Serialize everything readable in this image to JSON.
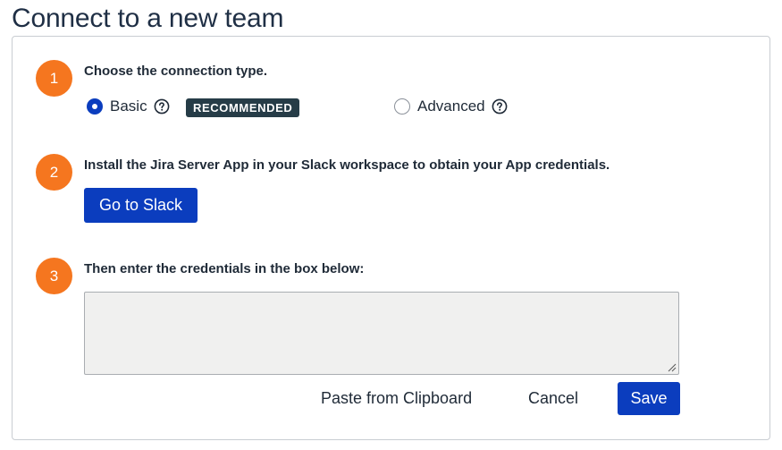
{
  "page": {
    "title": "Connect to a new team"
  },
  "steps": [
    {
      "number": "1",
      "text": "Choose the connection type."
    },
    {
      "number": "2",
      "text": "Install the Jira Server App in your Slack workspace to obtain your App credentials."
    },
    {
      "number": "3",
      "text": "Then enter the credentials in the box below:"
    }
  ],
  "connection_type": {
    "options": [
      {
        "label": "Basic",
        "selected": true,
        "badge": "RECOMMENDED",
        "icon": "help-circle-icon"
      },
      {
        "label": "Advanced",
        "selected": false,
        "icon": "help-circle-icon"
      }
    ]
  },
  "go_to_slack": {
    "label": "Go to Slack"
  },
  "credentials": {
    "value": "",
    "placeholder": ""
  },
  "actions": {
    "paste_label": "Paste from Clipboard",
    "cancel_label": "Cancel",
    "save_label": "Save"
  },
  "colors": {
    "step_badge": "#f5761f",
    "primary": "#0b3dbe",
    "badge_bg": "#263c47"
  }
}
